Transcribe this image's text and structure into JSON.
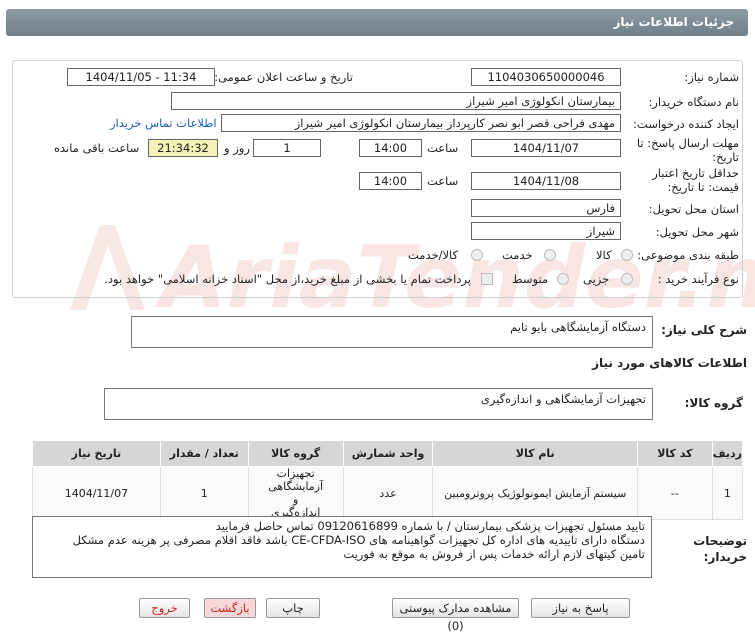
{
  "header": {
    "title": "جزئیات اطلاعات نیاز"
  },
  "form": {
    "need_number_label": "شماره نیاز:",
    "need_number": "1104030650000046",
    "announce_label": "تاریخ و ساعت اعلان عمومی:",
    "announce_value": "1404/11/05 - 11:34",
    "buyer_org_label": "نام دستگاه خریدار:",
    "buyer_org": "بیمارستان انکولوژی امیر شیراز",
    "creator_label": "ایجاد کننده درخواست:",
    "creator": "مهدی فراحی قصر ابو نصر کارپرداز بیمارستان انکولوژی امیر شیراز",
    "contact_link": "اطلاعات تماس خریدار",
    "reply_deadline_label": "مهلت ارسال پاسخ: تا تاریخ:",
    "reply_date": "1404/11/07",
    "time_label": "ساعت",
    "reply_time": "14:00",
    "days_value": "1",
    "days_label": "روز و",
    "remaining_time": "21:34:32",
    "remaining_label": "ساعت باقی مانده",
    "min_validity_label": "حداقل تاریخ اعتبار قیمت: تا تاریخ:",
    "validity_date": "1404/11/08",
    "validity_time": "14:00",
    "province_label": "استان محل تحویل:",
    "province": "فارس",
    "city_label": "شهر محل تحویل:",
    "city": "شیراز",
    "category_label": "طبقه بندی موضوعی:",
    "category_options": [
      "کالا",
      "خدمت",
      "کالا/خدمت"
    ],
    "purchase_type_label": "نوع فرآیند خرید :",
    "purchase_options": [
      "جزیی",
      "متوسط"
    ],
    "payment_note": "پرداخت تمام یا بخشی از مبلغ خرید،از محل \"اسناد خزانه اسلامی\" خواهد بود."
  },
  "summary": {
    "label": "شرح کلی نیاز:",
    "value": "دستگاه آزمایشگاهی بایو تایم"
  },
  "goods": {
    "section_title": "اطلاعات کالاهای مورد نیاز",
    "group_label": "گروه کالا:",
    "group_value": "تجهیزات آزمایشگاهی و اندازه‌گیری"
  },
  "table": {
    "headers": [
      "ردیف",
      "کد کالا",
      "نام کالا",
      "واحد شمارش",
      "گروه کالا",
      "تعداد / مقدار",
      "تاریخ نیاز"
    ],
    "rows": [
      {
        "row": "1",
        "code": "--",
        "name": "سیستم آزمایش ایمونولوژیک پروترومبین",
        "unit": "عدد",
        "group": "تجهیزات آزمایشگاهی و اندازه‌گیری",
        "qty": "1",
        "date": "1404/11/07"
      }
    ]
  },
  "notes": {
    "label": "توضیحات خریدار:",
    "lines": [
      "تایید مسئول تجهیزات پزشکی بیمارستان / با شماره 09120616899 تماس حاصل فرمایید",
      "دستگاه دارای تاییدیه های اداره کل تجهیزات گواهینامه های CE-CFDA-ISO باشد فاقد اقلام مصرفی پر هزینه عدم مشکل",
      "تامین کیتهای لازم ارائه خدمات پس از فروش به موقع به فوریت"
    ]
  },
  "buttons": {
    "reply": "پاسخ به نیاز",
    "attachments": "مشاهده مدارک پیوستی (0)",
    "print": "چاپ",
    "back": "بازگشت",
    "exit": "خروج"
  },
  "watermark": {
    "text": "AriaTender.neT"
  }
}
